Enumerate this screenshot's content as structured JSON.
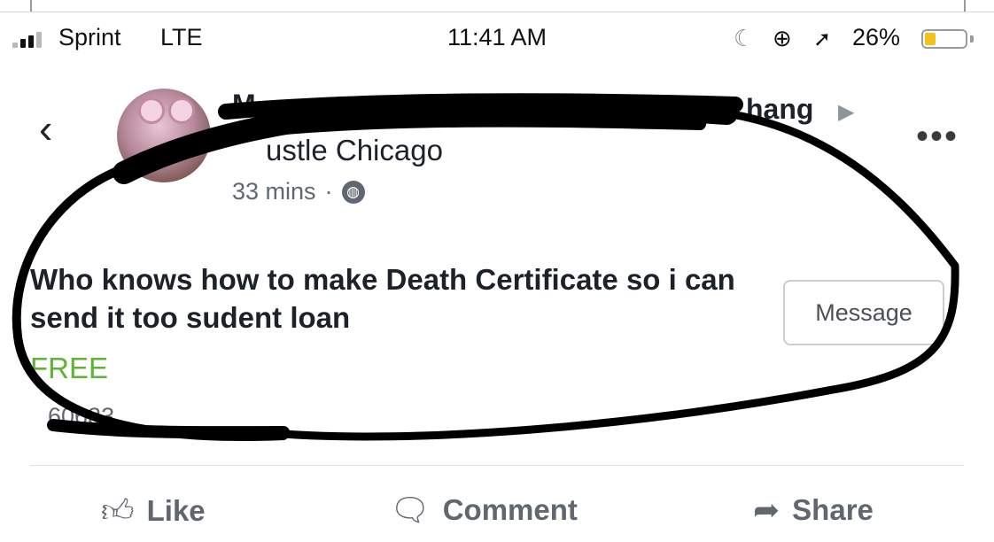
{
  "status_bar": {
    "carrier": "Sprint",
    "network": "LTE",
    "time": "11:41 AM",
    "battery_percent": "26%",
    "battery_fill_fraction": 0.26,
    "battery_color": "#f2c21a",
    "icons": [
      "signal-icon",
      "moon-icon",
      "rotation-lock-icon",
      "location-arrow-icon",
      "battery-icon"
    ]
  },
  "post": {
    "author_start": "M",
    "author_end": "hang",
    "group_name": "ustle Chicago",
    "time_ago": "33 mins",
    "separator": "·",
    "privacy_icon": "globe-icon",
    "title": "Who knows how to make Death Certificate so i can send it too sudent loan",
    "price": "FREE",
    "location": "60633",
    "message_button": "Message",
    "price_color": "#5fb236"
  },
  "actions": {
    "like": "Like",
    "comment": "Comment",
    "share": "Share"
  },
  "annotation": {
    "marker_color": "#000000"
  }
}
